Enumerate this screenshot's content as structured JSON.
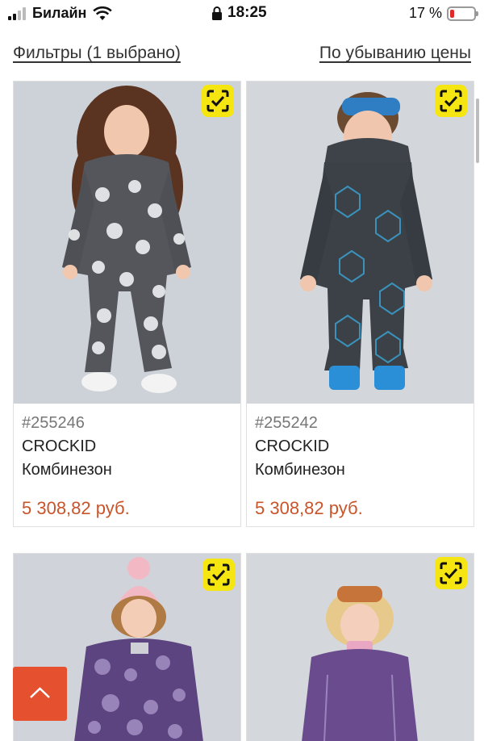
{
  "status_bar": {
    "carrier": "Билайн",
    "time": "18:25",
    "battery_percent": "17 %",
    "battery_level": 0.17
  },
  "toolbar": {
    "filters_label": "Фильтры (1 выбрано)",
    "sort_label": "По убыванию цены"
  },
  "products": [
    {
      "sku": "#255246",
      "brand": "CROCKID",
      "type": "Комбинезон",
      "price": "5 308,82 руб."
    },
    {
      "sku": "#255242",
      "brand": "CROCKID",
      "type": "Комбинезон",
      "price": "5 308,82 руб."
    }
  ],
  "colors": {
    "price": "#c9542a",
    "badge": "#f5e511",
    "to_top_button": "#e5502f"
  },
  "icons": {
    "badge": "scan-check-icon",
    "to_top": "chevron-up-icon"
  }
}
